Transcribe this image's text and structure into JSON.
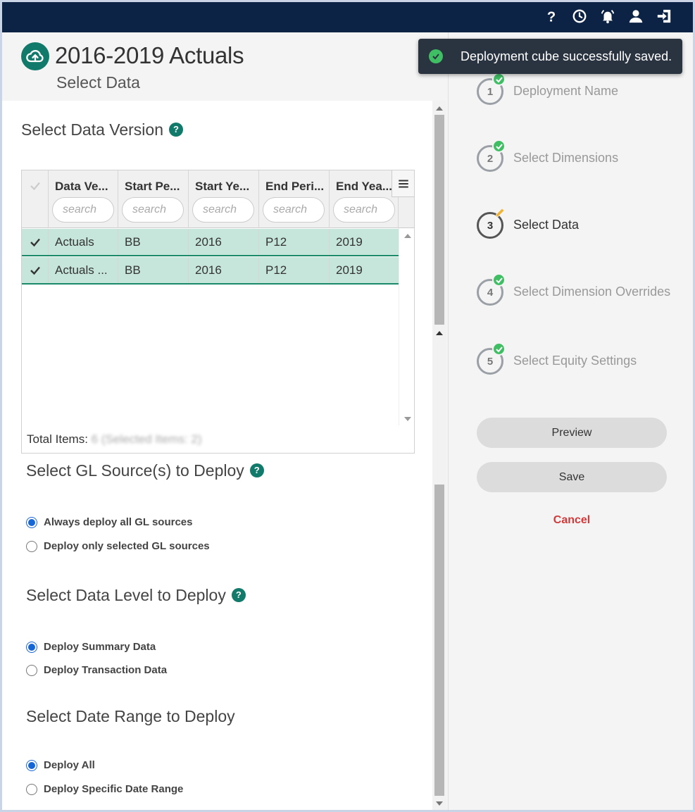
{
  "header": {
    "title": "2016-2019 Actuals",
    "subtitle": "Select Data"
  },
  "topbar": {
    "icons": [
      "help-icon",
      "history-clock-icon",
      "alarm-bell-icon",
      "user-icon",
      "logout-icon"
    ]
  },
  "toast": {
    "message": "Deployment cube successfully saved.",
    "status_color": "#3fbe64"
  },
  "data_version": {
    "title": "Select Data Version",
    "help": "?",
    "columns": [
      {
        "label": "Data Ve...",
        "placeholder": "search"
      },
      {
        "label": "Start Pe...",
        "placeholder": "search"
      },
      {
        "label": "Start Ye...",
        "placeholder": "search"
      },
      {
        "label": "End Peri...",
        "placeholder": "search"
      },
      {
        "label": "End Yea...",
        "placeholder": "search"
      }
    ],
    "rows": [
      {
        "data_version": "Actuals",
        "start_period": "BB",
        "start_year": "2016",
        "end_period": "P12",
        "end_year": "2019",
        "selected": true
      },
      {
        "data_version": "Actuals ...",
        "start_period": "BB",
        "start_year": "2016",
        "end_period": "P12",
        "end_year": "2019",
        "selected": true
      }
    ],
    "total_label": "Total Items:",
    "total_value": "6 (Selected Items: 2)"
  },
  "gl_sources": {
    "title": "Select GL Source(s) to Deploy",
    "help": "?",
    "options": [
      {
        "label": "Always deploy all GL sources",
        "checked": true
      },
      {
        "label": "Deploy only selected GL sources",
        "checked": false
      }
    ]
  },
  "data_level": {
    "title": "Select Data Level to Deploy",
    "help": "?",
    "options": [
      {
        "label": "Deploy Summary Data",
        "checked": true
      },
      {
        "label": "Deploy Transaction Data",
        "checked": false
      }
    ]
  },
  "date_range": {
    "title": "Select Date Range to Deploy",
    "options": [
      {
        "label": "Deploy All",
        "checked": true
      },
      {
        "label": "Deploy Specific Date Range",
        "checked": false
      }
    ]
  },
  "steps": [
    {
      "number": "1",
      "label": "Deployment Name",
      "state": "done"
    },
    {
      "number": "2",
      "label": "Select Dimensions",
      "state": "done"
    },
    {
      "number": "3",
      "label": "Select Data",
      "state": "active"
    },
    {
      "number": "4",
      "label": "Select Dimension Overrides",
      "state": "done"
    },
    {
      "number": "5",
      "label": "Select Equity Settings",
      "state": "done"
    }
  ],
  "actions": {
    "preview": "Preview",
    "save": "Save",
    "cancel": "Cancel"
  },
  "colors": {
    "topbar": "#0c2345",
    "accent": "#127a6a",
    "selected_row": "#c6e6db",
    "cancel": "#d03a3a",
    "success": "#3fbe64"
  }
}
